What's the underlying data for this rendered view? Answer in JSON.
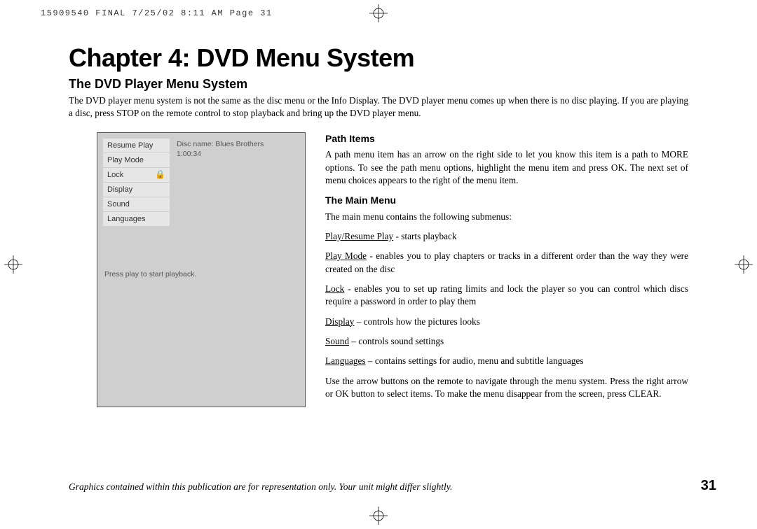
{
  "slug": "15909540 FINAL  7/25/02  8:11 AM  Page 31",
  "chapter_title": "Chapter 4: DVD Menu System",
  "section_title": "The DVD Player Menu System",
  "intro": "The DVD player menu system is not the same as the disc menu or the Info Display. The DVD player menu comes up when there is no disc playing. If you are playing a disc, press STOP on the remote control to stop playback and bring up the DVD player menu.",
  "screenshot": {
    "menu_items": [
      "Resume Play",
      "Play Mode",
      "Lock",
      "Display",
      "Sound",
      "Languages"
    ],
    "lock_icon": "🔒",
    "disc_name_line": "Disc name: Blues Brothers",
    "duration": "1:00:34",
    "prompt": "Press play to start playback."
  },
  "path_heading": "Path Items",
  "path_para": "A path menu item has an arrow on the right side to let you know this item is a path to MORE options. To see the path menu options, highlight the menu item and press OK. The next set of menu choices appears to the right of the menu item.",
  "main_heading": "The Main Menu",
  "main_intro": "The main menu contains the following submenus:",
  "items": {
    "play_label": "Play/Resume Play",
    "play_desc": " - starts playback",
    "mode_label": "Play Mode",
    "mode_desc": " - enables you to play chapters or tracks in a different order than the way they were created on the disc",
    "lock_label": "Lock",
    "lock_desc": " - enables you to set up rating limits and lock the player so you can control which discs require a password in order to play them",
    "display_label": "Display",
    "display_desc": " – controls how the pictures looks",
    "sound_label": "Sound",
    "sound_desc": " – controls sound settings",
    "lang_label": "Languages",
    "lang_desc": " – contains settings for audio, menu and subtitle languages"
  },
  "nav_para": "Use the arrow buttons on the remote to navigate through the menu system. Press the right arrow or OK button to select items. To make the menu disappear from the screen, press CLEAR.",
  "footer_note": "Graphics contained within this publication are for representation only. Your unit might differ slightly.",
  "page_num": "31"
}
